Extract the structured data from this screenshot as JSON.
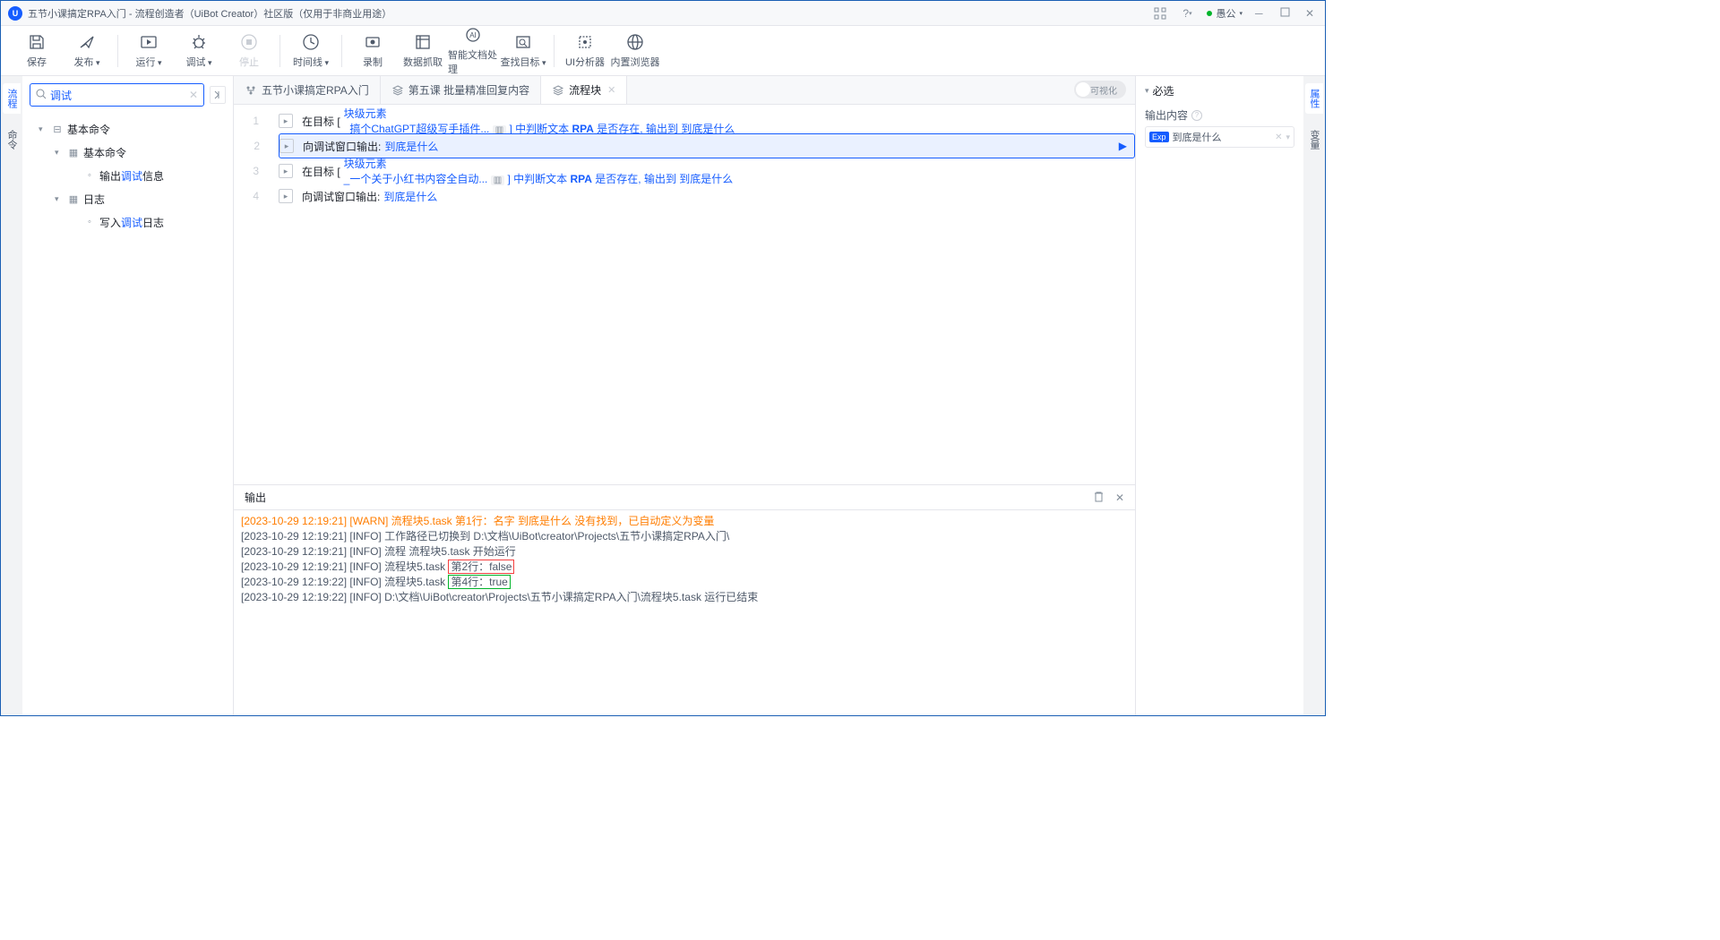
{
  "titlebar": {
    "title": "五节小课搞定RPA入门 - 流程创造者（UiBot Creator）社区版（仅用于非商业用途）",
    "user": "愚公"
  },
  "toolbar": [
    {
      "label": "保存",
      "id": "save"
    },
    {
      "label": "发布",
      "id": "publish",
      "dropdown": true
    },
    {
      "label": "运行",
      "id": "run",
      "dropdown": true,
      "sep_before": true
    },
    {
      "label": "调试",
      "id": "debug",
      "dropdown": true
    },
    {
      "label": "停止",
      "id": "stop",
      "disabled": true
    },
    {
      "label": "时间线",
      "id": "timeline",
      "dropdown": true,
      "sep_before": true
    },
    {
      "label": "录制",
      "id": "record",
      "sep_before": true
    },
    {
      "label": "数据抓取",
      "id": "scrape"
    },
    {
      "label": "智能文档处理",
      "id": "doc"
    },
    {
      "label": "查找目标",
      "id": "find",
      "dropdown": true
    },
    {
      "label": "UI分析器",
      "id": "ui-analyzer",
      "sep_before": true
    },
    {
      "label": "内置浏览器",
      "id": "browser"
    }
  ],
  "left_tabs": [
    "流程",
    "命令"
  ],
  "search_value": "调试",
  "tree": [
    {
      "level": 0,
      "caret": "▾",
      "type": "root",
      "icon": "⊟",
      "text": "基本命令"
    },
    {
      "level": 1,
      "caret": "▾",
      "type": "folder",
      "icon": "▦",
      "text": "基本命令"
    },
    {
      "level": 2,
      "caret": "",
      "type": "leaf",
      "icon": "◦",
      "pre": "输出",
      "hl": "调试",
      "post": "信息"
    },
    {
      "level": 1,
      "caret": "▾",
      "type": "folder",
      "icon": "▦",
      "text": "日志"
    },
    {
      "level": 2,
      "caret": "",
      "type": "leaf",
      "icon": "◦",
      "pre": "写入",
      "hl": "调试",
      "post": "日志"
    }
  ],
  "tabs": [
    {
      "icon": "flow",
      "label": "五节小课搞定RPA入门",
      "closable": false
    },
    {
      "icon": "stack",
      "label": "第五课 批量精准回复内容",
      "closable": false
    },
    {
      "icon": "block",
      "label": "流程块",
      "closable": true,
      "active": true
    }
  ],
  "viz_label": "可视化",
  "code": [
    {
      "n": 1,
      "type": "target",
      "pre": "在目标 [",
      "link1": "块级元素<div>_搞个ChatGPT超级写手插件...",
      "mid": "] 中判断文本 ",
      "kw": "RPA",
      "mid2": " 是否存在, 输出到  ",
      "out": "到底是什么"
    },
    {
      "n": 2,
      "type": "output",
      "selected": true,
      "pre": "向调试窗口输出:  ",
      "out": "到底是什么"
    },
    {
      "n": 3,
      "type": "target",
      "pre": "在目标 [",
      "link1": "块级元素<div>_一个关于小红书内容全自动...",
      "mid": "] 中判断文本 ",
      "kw": "RPA",
      "mid2": " 是否存在, 输出到  ",
      "out": "到底是什么"
    },
    {
      "n": 4,
      "type": "output",
      "pre": "向调试窗口输出:  ",
      "out": "到底是什么"
    }
  ],
  "output_title": "输出",
  "output_lines": [
    {
      "cls": "warn",
      "text": "[2023-10-29 12:19:21] [WARN] 流程块5.task 第1行：名字 到底是什么 没有找到，已自动定义为变量"
    },
    {
      "cls": "",
      "text": "[2023-10-29 12:19:21] [INFO] 工作路径已切换到 D:\\文档\\UiBot\\creator\\Projects\\五节小课搞定RPA入门\\"
    },
    {
      "cls": "",
      "text": "[2023-10-29 12:19:21] [INFO] 流程 流程块5.task 开始运行"
    },
    {
      "cls": "",
      "text": "[2023-10-29 12:19:21] [INFO] 流程块5.task",
      "boxed": "第2行：false",
      "boxcls": "boxed-red"
    },
    {
      "cls": "",
      "text": "[2023-10-29 12:19:22] [INFO] 流程块5.task",
      "boxed": "第4行：true",
      "boxcls": "boxed-green"
    },
    {
      "cls": "",
      "text": "[2023-10-29 12:19:22] [INFO] D:\\文档\\UiBot\\creator\\Projects\\五节小课搞定RPA入门\\流程块5.task 运行已结束"
    }
  ],
  "right": {
    "section": "必选",
    "field_label": "输出内容",
    "value_badge": "Exp",
    "value_text": "到底是什么"
  },
  "right_tabs": [
    "属性",
    "变量"
  ]
}
